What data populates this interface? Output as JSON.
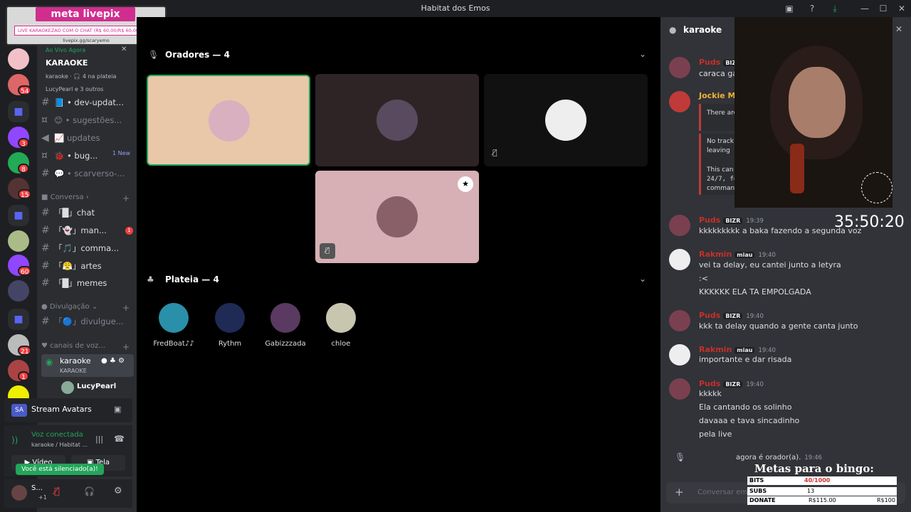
{
  "window": {
    "title": "Habitat dos Emos"
  },
  "overlay": {
    "brand": "meta livepix",
    "goal_text": "LIVE KARAOKEZAO COM O CHAT (R$ 60,00/R$ 60,00)",
    "url": "livepix.gg/scaryemo"
  },
  "servers": {
    "badges": [
      "54",
      "3",
      "8",
      "15",
      "60",
      "21",
      "1"
    ]
  },
  "event": {
    "live_label": "Ao Vivo Agora",
    "title": "KARAOKE",
    "meta": "karaoke · 🎧 4 na plateia",
    "participants": "LucyPearl e 3 outros"
  },
  "channels": [
    {
      "name": "• dev-updat...",
      "icon": "📘"
    },
    {
      "name": "• sugestões...",
      "icon": "😊"
    },
    {
      "name": "updates",
      "icon": "📈"
    },
    {
      "name": "• bug...",
      "icon": "🐞",
      "badge": "1 New"
    },
    {
      "name": "• scarverso-...",
      "icon": "💬"
    }
  ],
  "categories": {
    "conversa": "Conversa",
    "divulgacao": "Divulgação",
    "voice": "canais de voz..."
  },
  "conversa_channels": [
    {
      "name": "「█」chat"
    },
    {
      "name": "「👻」man...",
      "badge": "1"
    },
    {
      "name": "「🎵」comma..."
    },
    {
      "name": "「😤」artes"
    },
    {
      "name": "「█」memes"
    }
  ],
  "divulgacao_channel": "「🔵」divulgue...",
  "voice_channel": {
    "name": "karaoke",
    "sub": "KARAOKE",
    "member": "LucyPearl"
  },
  "stream_avatars": "Stream Avatars",
  "voice_status": {
    "label": "Voz conectada",
    "sub": "karaoke / Habitat ...",
    "video": "Vídeo",
    "screen": "Tela",
    "toast": "Você está silenciado(a)!"
  },
  "user": {
    "name": "S...",
    "sub": "+1"
  },
  "stage": {
    "speakers_header": "Oradores — 4",
    "audience_header": "Plateia — 4"
  },
  "audience": [
    {
      "name": "FredBoat♪♪"
    },
    {
      "name": "Rythm"
    },
    {
      "name": "Gabizzzada"
    },
    {
      "name": "chloe"
    }
  ],
  "chat": {
    "channel": "karaoke",
    "input_placeholder": "Conversar em",
    "messages": [
      {
        "name": "Puds",
        "tag": "BIZR",
        "time": "",
        "lines": [
          "caraca ga"
        ]
      },
      {
        "name": "Jockie Mu",
        "tag": "",
        "time": "",
        "lines": [
          "There are",
          "No track",
          "leaving",
          "This can",
          "24/7, fo",
          "comman"
        ]
      },
      {
        "name": "Puds",
        "tag": "BIZR",
        "time": "19:39",
        "lines": [
          "kkkkkkkkk a baka fazendo a segunda voz"
        ]
      },
      {
        "name": "Rakmin",
        "tag": "miau",
        "time": "19:40",
        "lines": [
          "vei ta delay, eu cantei junto a letyra",
          ":<",
          "KKKKKK ELA TA EMPOLGADA"
        ]
      },
      {
        "name": "Puds",
        "tag": "BIZR",
        "time": "19:40",
        "lines": [
          "kkk ta delay quando a gente canta junto"
        ]
      },
      {
        "name": "Rakmin",
        "tag": "miau",
        "time": "19:40",
        "lines": [
          "importante e dar risada"
        ]
      },
      {
        "name": "Puds",
        "tag": "BIZR",
        "time": "19:40",
        "lines": [
          "kkkkk",
          "Ela cantando os solinho",
          "davaaa e tava sincadinho",
          "pela live"
        ]
      }
    ],
    "system": {
      "text": "agora é orador(a).",
      "time": "19:46"
    }
  },
  "timer": "35:50:20",
  "goals": {
    "title": "Metas para o bingo:",
    "rows": [
      {
        "label": "BITS",
        "value": "40/1000",
        "fill": 0.04
      },
      {
        "label": "SUBS",
        "value": "13",
        "fill": 0.65
      },
      {
        "label": "DONATE",
        "value": "R$115.00",
        "end": "R$100",
        "fill": 1.0
      }
    ]
  },
  "colors": {
    "accent": "#5865f2",
    "green": "#23a55a",
    "red": "#f23f43"
  }
}
